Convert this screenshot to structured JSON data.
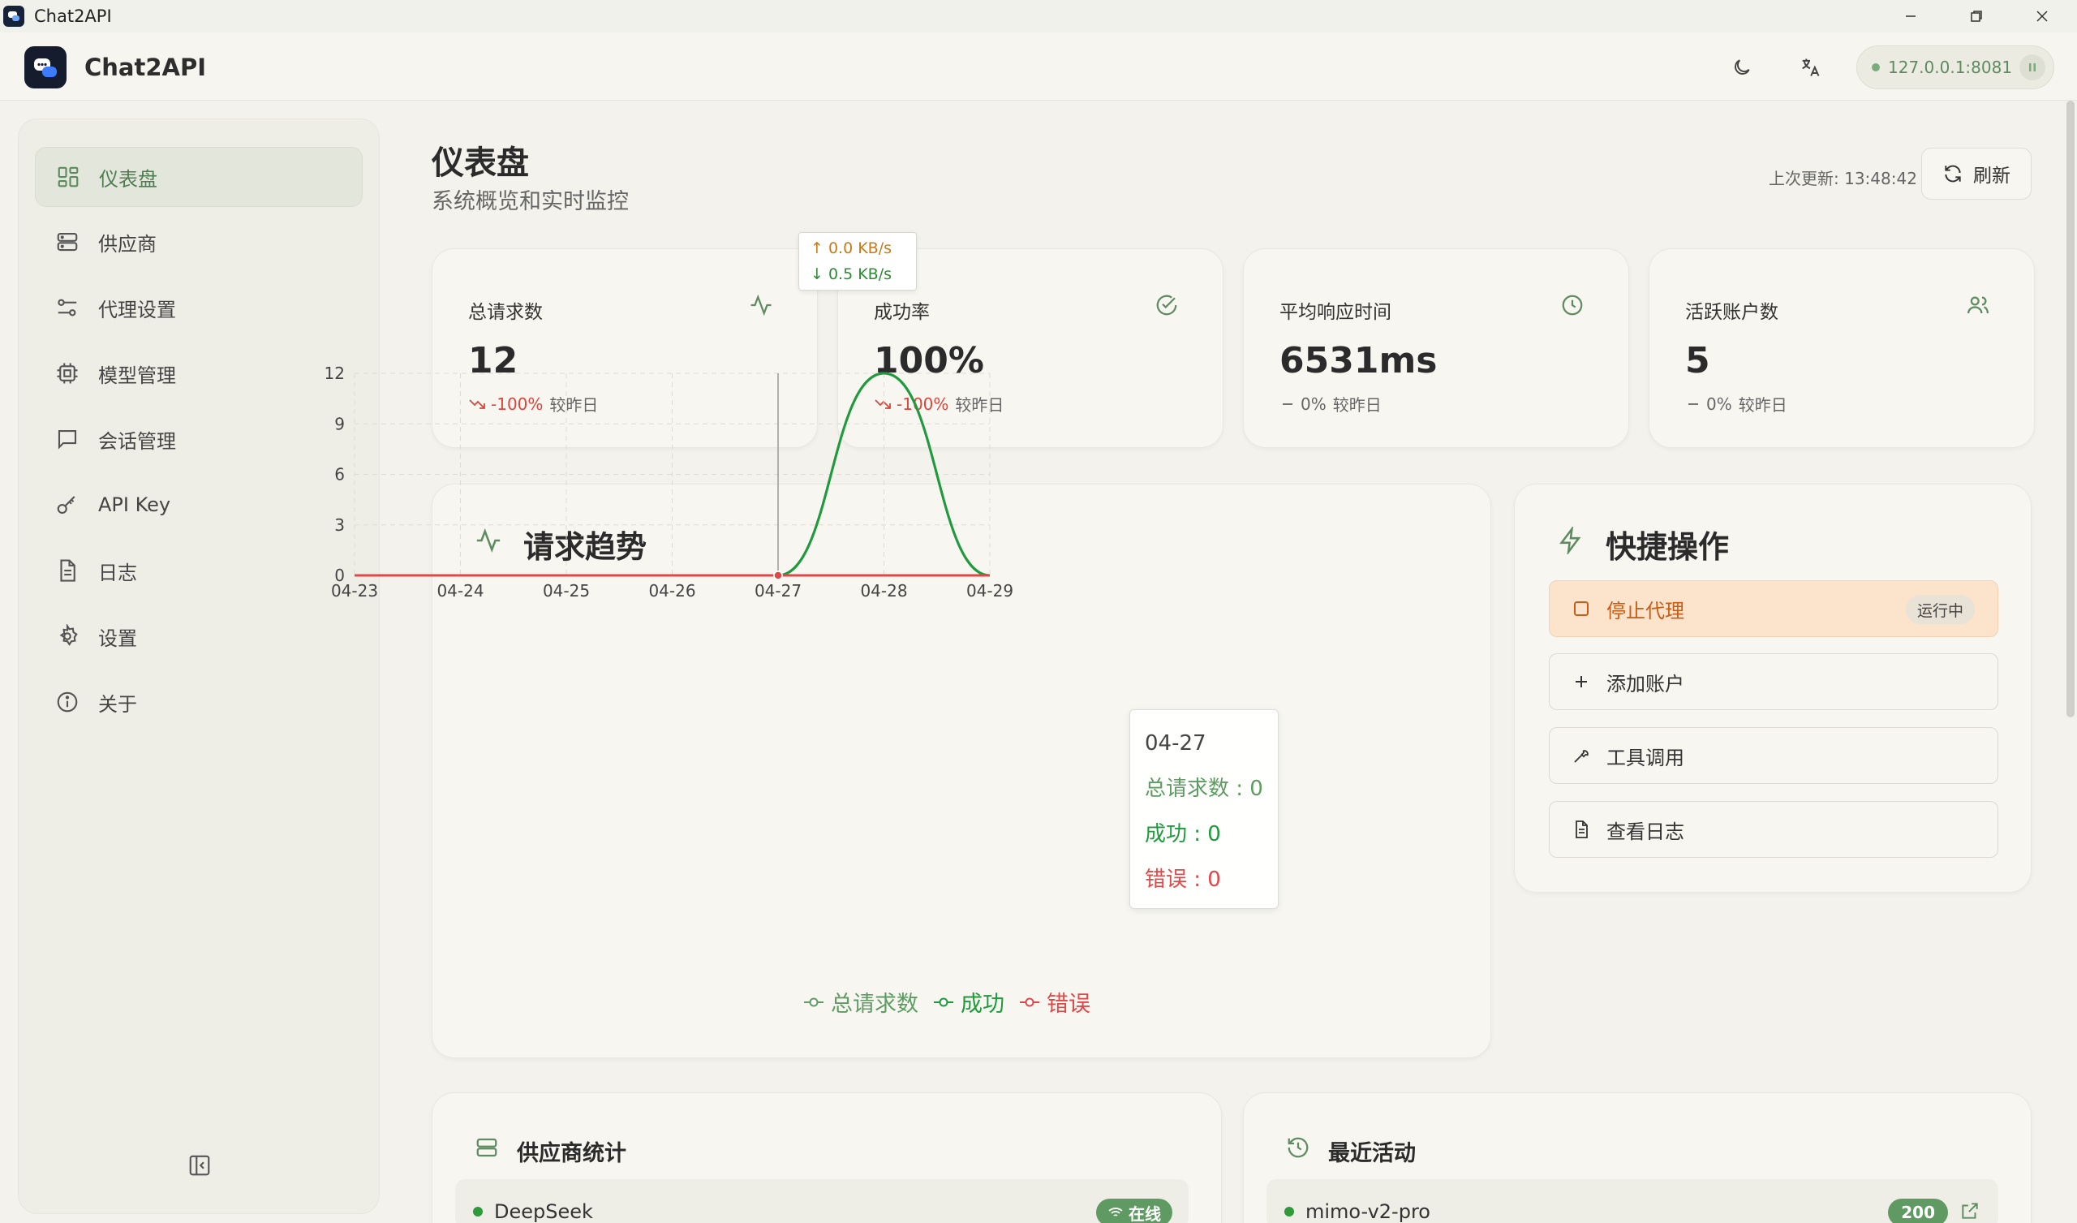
{
  "window": {
    "title": "Chat2API"
  },
  "header": {
    "brand": "Chat2API",
    "server_address": "127.0.0.1:8081"
  },
  "sidebar": {
    "items": [
      {
        "label": "仪表盘",
        "icon": "grid-icon",
        "active": true
      },
      {
        "label": "供应商",
        "icon": "server-icon"
      },
      {
        "label": "代理设置",
        "icon": "sliders-icon"
      },
      {
        "label": "模型管理",
        "icon": "chip-icon"
      },
      {
        "label": "会话管理",
        "icon": "message-icon"
      },
      {
        "label": "API Key",
        "icon": "key-icon"
      },
      {
        "label": "日志",
        "icon": "file-text-icon"
      },
      {
        "label": "设置",
        "icon": "gear-icon"
      },
      {
        "label": "关于",
        "icon": "info-icon"
      }
    ]
  },
  "page": {
    "title": "仪表盘",
    "subtitle": "系统概览和实时监控",
    "last_update_label": "上次更新: 13:48:42",
    "refresh_label": "刷新"
  },
  "network": {
    "up": "↑ 0.0 KB/s",
    "down": "↓ 0.5 KB/s"
  },
  "stats": [
    {
      "label": "总请求数",
      "value": "12",
      "delta": "-100%",
      "delta_suffix": "较昨日",
      "trend": "down",
      "icon": "activity-icon"
    },
    {
      "label": "成功率",
      "value": "100%",
      "delta": "-100%",
      "delta_suffix": "较昨日",
      "trend": "down",
      "icon": "check-circle-icon"
    },
    {
      "label": "平均响应时间",
      "value": "6531ms",
      "delta": "0%",
      "delta_suffix": "较昨日",
      "trend": "flat",
      "icon": "clock-icon"
    },
    {
      "label": "活跃账户数",
      "value": "5",
      "delta": "0%",
      "delta_suffix": "较昨日",
      "trend": "flat",
      "icon": "users-icon"
    }
  ],
  "trend_chart": {
    "title": "请求趋势",
    "tooltip": {
      "date": "04-27",
      "total": "总请求数 : 0",
      "success": "成功 : 0",
      "error": "错误 : 0"
    },
    "legend": [
      "总请求数",
      "成功",
      "错误"
    ]
  },
  "chart_data": {
    "type": "line",
    "title": "请求趋势",
    "x": [
      "04-23",
      "04-24",
      "04-25",
      "04-26",
      "04-27",
      "04-28",
      "04-29"
    ],
    "series": [
      {
        "name": "总请求数",
        "values": [
          0,
          0,
          0,
          0,
          0,
          12,
          0
        ],
        "color": "#5e9c63"
      },
      {
        "name": "成功",
        "values": [
          0,
          0,
          0,
          0,
          0,
          12,
          0
        ],
        "color": "#1f9a3d"
      },
      {
        "name": "错误",
        "values": [
          0,
          0,
          0,
          0,
          0,
          0,
          0
        ],
        "color": "#e04848"
      }
    ],
    "yticks": [
      0,
      3,
      6,
      9,
      12
    ],
    "ylim": [
      0,
      12
    ],
    "grid": true,
    "legend_position": "bottom",
    "smooth": true
  },
  "quick_actions": {
    "title": "快捷操作",
    "items": [
      {
        "label": "停止代理",
        "badge": "运行中",
        "icon": "square-icon"
      },
      {
        "label": "添加账户",
        "icon": "plus-icon"
      },
      {
        "label": "工具调用",
        "icon": "wrench-icon"
      },
      {
        "label": "查看日志",
        "icon": "file-text-icon"
      }
    ]
  },
  "provider_stats": {
    "title": "供应商统计",
    "rows": [
      {
        "name": "DeepSeek",
        "status": "在线"
      }
    ]
  },
  "recent_activity": {
    "title": "最近活动",
    "rows": [
      {
        "name": "mimo-v2-pro",
        "code": "200"
      }
    ]
  },
  "colors": {
    "accent": "#5f8b61",
    "success": "#1f9a3d",
    "error": "#e04848",
    "warning_bg": "#fbe3cc"
  }
}
